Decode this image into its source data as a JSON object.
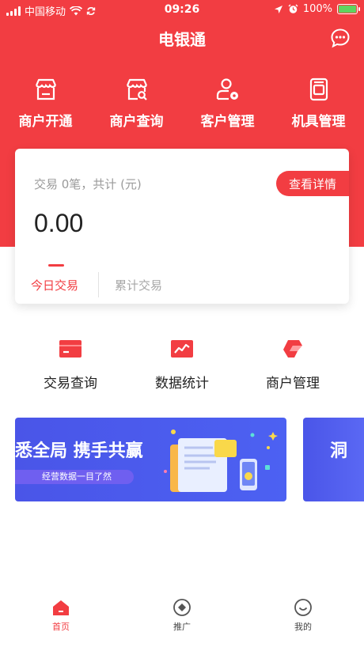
{
  "status_bar": {
    "carrier": "中国移动",
    "time": "09:26",
    "battery": "100%",
    "battery_level": 1.0
  },
  "header": {
    "title": "电银通",
    "chat_icon": "chat-bubble-icon"
  },
  "top_menu": [
    {
      "label": "商户开通",
      "icon": "store-open-icon"
    },
    {
      "label": "商户查询",
      "icon": "store-search-icon"
    },
    {
      "label": "客户管理",
      "icon": "user-manage-icon"
    },
    {
      "label": "机具管理",
      "icon": "device-manage-icon"
    }
  ],
  "card": {
    "summary": "交易 0笔，共计 (元)",
    "detail_button": "查看详情",
    "amount": "0.00",
    "tabs": [
      "今日交易",
      "累计交易"
    ]
  },
  "features": [
    {
      "label": "交易查询",
      "icon": "transaction-card-icon"
    },
    {
      "label": "数据统计",
      "icon": "chart-icon"
    },
    {
      "label": "商户管理",
      "icon": "store-manage-icon"
    }
  ],
  "banners": [
    {
      "title": "悉全局 携手共赢",
      "pill": "经营数据一目了然"
    },
    {
      "title": "洞"
    }
  ],
  "bottom_nav": [
    {
      "label": "首页",
      "icon": "home-icon",
      "active": true
    },
    {
      "label": "推广",
      "icon": "promote-icon",
      "active": false
    },
    {
      "label": "我的",
      "icon": "profile-icon",
      "active": false
    }
  ],
  "colors": {
    "primary": "#f23d42",
    "banner": "#4a55e8",
    "text": "#222222",
    "muted": "#9a9a9a"
  }
}
